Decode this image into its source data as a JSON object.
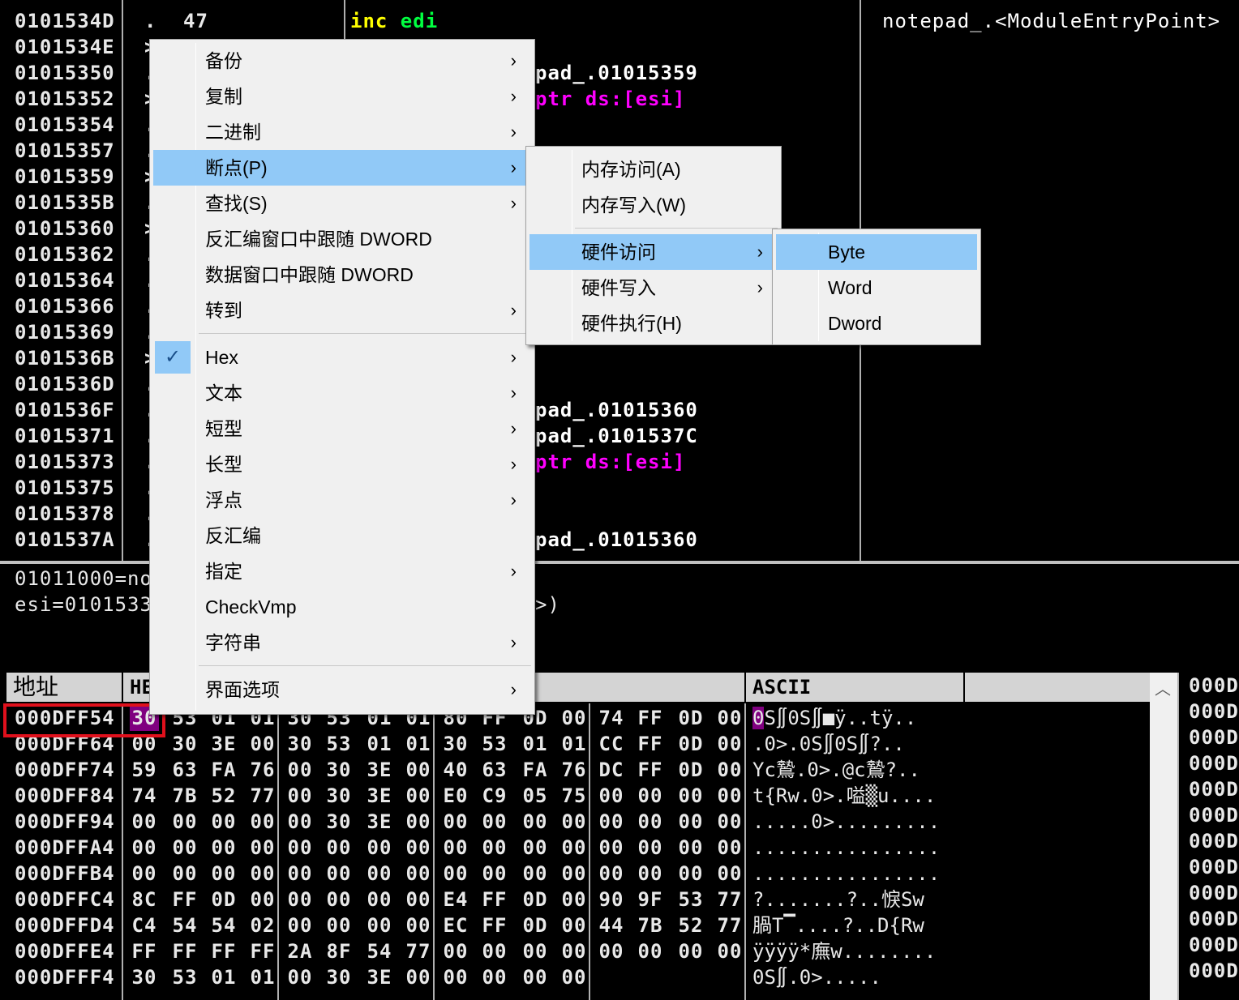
{
  "disasm": {
    "rows": [
      {
        "addr": "0101534D",
        "mark": ".",
        "bytes": "47",
        "instr": [
          {
            "t": "inc ",
            "c": "kw-y"
          },
          {
            "t": "edi",
            "c": "kw-g"
          }
        ]
      },
      {
        "addr": "0101534E",
        "mark": ">",
        "bytes": "",
        "instr": []
      },
      {
        "addr": "01015350",
        "mark": ".",
        "bytes": "",
        "instr": [
          {
            "t": "pad_.01015359",
            "c": "txt-w"
          }
        ]
      },
      {
        "addr": "01015352",
        "mark": ">",
        "bytes": "",
        "instr": [
          {
            "t": "ptr ds:[esi]",
            "c": "mag"
          }
        ]
      },
      {
        "addr": "01015354",
        "mark": ".",
        "bytes": "",
        "instr": []
      },
      {
        "addr": "01015357",
        "mark": ".",
        "bytes": "",
        "instr": []
      },
      {
        "addr": "01015359",
        "mark": ">",
        "bytes": "",
        "instr": []
      },
      {
        "addr": "0101535B",
        "mark": ".",
        "bytes": "",
        "instr": []
      },
      {
        "addr": "01015360",
        "mark": ">",
        "bytes": "",
        "instr": []
      },
      {
        "addr": "01015362",
        "mark": ".",
        "bytes": "",
        "instr": []
      },
      {
        "addr": "01015364",
        "mark": ".",
        "bytes": "",
        "instr": []
      },
      {
        "addr": "01015366",
        "mark": ".",
        "bytes": "",
        "instr": []
      },
      {
        "addr": "01015369",
        "mark": ".",
        "bytes": "",
        "instr": []
      },
      {
        "addr": "0101536B",
        "mark": ">",
        "bytes": "",
        "instr": []
      },
      {
        "addr": "0101536D",
        "mark": ".",
        "bytes": "",
        "instr": []
      },
      {
        "addr": "0101536F",
        "mark": ".",
        "bytes": "",
        "instr": [
          {
            "t": "pad_.01015360",
            "c": "txt-w"
          }
        ]
      },
      {
        "addr": "01015371",
        "mark": ".",
        "bytes": "",
        "instr": [
          {
            "t": "pad_.0101537C",
            "c": "txt-w"
          }
        ]
      },
      {
        "addr": "01015373",
        "mark": ".",
        "bytes": "",
        "instr": [
          {
            "t": "ptr ds:[esi]",
            "c": "mag"
          }
        ]
      },
      {
        "addr": "01015375",
        "mark": ".",
        "bytes": "",
        "instr": []
      },
      {
        "addr": "01015378",
        "mark": ".",
        "bytes": "",
        "instr": []
      },
      {
        "addr": "0101537A",
        "mark": ".",
        "bytes": "",
        "instr": [
          {
            "t": "pad_.01015360",
            "c": "txt-w"
          }
        ]
      }
    ],
    "comment": "notepad_.<ModuleEntryPoint>"
  },
  "info": {
    "line1": "01011000=no",
    "line2": "esi=0101533",
    "line2_tail": ">)"
  },
  "dump": {
    "col_addr": "地址",
    "col_hex": "HE",
    "col_ascii": "ASCII",
    "right_col": "000D",
    "rows": [
      {
        "addr": "000DFF54",
        "hex": [
          "30",
          "53",
          "01",
          "01",
          "30",
          "53",
          "01",
          "01",
          "80",
          "FF",
          "0D",
          "00",
          "74",
          "FF",
          "0D",
          "00"
        ],
        "ascii": "0S∬0S∬■ÿ..tÿ.."
      },
      {
        "addr": "000DFF64",
        "hex": [
          "00",
          "30",
          "3E",
          "00",
          "30",
          "53",
          "01",
          "01",
          "30",
          "53",
          "01",
          "01",
          "CC",
          "FF",
          "0D",
          "00"
        ],
        "ascii": ".0>.0S∬0S∬?.."
      },
      {
        "addr": "000DFF74",
        "hex": [
          "59",
          "63",
          "FA",
          "76",
          "00",
          "30",
          "3E",
          "00",
          "40",
          "63",
          "FA",
          "76",
          "DC",
          "FF",
          "0D",
          "00"
        ],
        "ascii": "Yc鷙.0>.@c鷙?.."
      },
      {
        "addr": "000DFF84",
        "hex": [
          "74",
          "7B",
          "52",
          "77",
          "00",
          "30",
          "3E",
          "00",
          "E0",
          "C9",
          "05",
          "75",
          "00",
          "00",
          "00",
          "00"
        ],
        "ascii": "t{Rw.0>.嗌▒u...."
      },
      {
        "addr": "000DFF94",
        "hex": [
          "00",
          "00",
          "00",
          "00",
          "00",
          "30",
          "3E",
          "00",
          "00",
          "00",
          "00",
          "00",
          "00",
          "00",
          "00",
          "00"
        ],
        "ascii": ".....0>........."
      },
      {
        "addr": "000DFFA4",
        "hex": [
          "00",
          "00",
          "00",
          "00",
          "00",
          "00",
          "00",
          "00",
          "00",
          "00",
          "00",
          "00",
          "00",
          "00",
          "00",
          "00"
        ],
        "ascii": "................"
      },
      {
        "addr": "000DFFB4",
        "hex": [
          "00",
          "00",
          "00",
          "00",
          "00",
          "00",
          "00",
          "00",
          "00",
          "00",
          "00",
          "00",
          "00",
          "00",
          "00",
          "00"
        ],
        "ascii": "................"
      },
      {
        "addr": "000DFFC4",
        "hex": [
          "8C",
          "FF",
          "0D",
          "00",
          "00",
          "00",
          "00",
          "00",
          "E4",
          "FF",
          "0D",
          "00",
          "90",
          "9F",
          "53",
          "77"
        ],
        "ascii": "?.......?..悷Sw"
      },
      {
        "addr": "000DFFD4",
        "hex": [
          "C4",
          "54",
          "54",
          "02",
          "00",
          "00",
          "00",
          "00",
          "EC",
          "FF",
          "0D",
          "00",
          "44",
          "7B",
          "52",
          "77"
        ],
        "ascii": "腡T▔....?..D{Rw"
      },
      {
        "addr": "000DFFE4",
        "hex": [
          "FF",
          "FF",
          "FF",
          "FF",
          "2A",
          "8F",
          "54",
          "77",
          "00",
          "00",
          "00",
          "00",
          "00",
          "00",
          "00",
          "00"
        ],
        "ascii": "ÿÿÿÿ*廡w........"
      },
      {
        "addr": "000DFFF4",
        "hex": [
          "30",
          "53",
          "01",
          "01",
          "00",
          "30",
          "3E",
          "00",
          "00",
          "00",
          "00",
          "00",
          "",
          "",
          "",
          ""
        ],
        "ascii": "0S∬.0>....."
      }
    ]
  },
  "menu": {
    "items": [
      {
        "label": "备份",
        "sub": true
      },
      {
        "label": "复制",
        "sub": true
      },
      {
        "label": "二进制",
        "sub": true
      },
      {
        "label": "断点(P)",
        "sub": true,
        "selected": true
      },
      {
        "label": "查找(S)",
        "sub": true
      },
      {
        "label": "反汇编窗口中跟随 DWORD",
        "sub": false
      },
      {
        "label": "数据窗口中跟随 DWORD",
        "sub": false
      },
      {
        "label": "转到",
        "sub": true
      },
      {
        "label": "Hex",
        "sub": true,
        "checked": true
      },
      {
        "label": "文本",
        "sub": true
      },
      {
        "label": "短型",
        "sub": true
      },
      {
        "label": "长型",
        "sub": true
      },
      {
        "label": "浮点",
        "sub": true
      },
      {
        "label": "反汇编",
        "sub": false
      },
      {
        "label": "指定",
        "sub": true
      },
      {
        "label": "CheckVmp",
        "sub": false
      },
      {
        "label": "字符串",
        "sub": true
      },
      {
        "label": "界面选项",
        "sub": true
      }
    ],
    "arrow_glyph": "›",
    "check_glyph": "✓"
  },
  "submenu_breakpoint": {
    "items": [
      {
        "label": "内存访问(A)",
        "sub": false
      },
      {
        "label": "内存写入(W)",
        "sub": false
      },
      {
        "label": "硬件访问",
        "sub": true,
        "selected": true
      },
      {
        "label": "硬件写入",
        "sub": true
      },
      {
        "label": "硬件执行(H)",
        "sub": false
      }
    ]
  },
  "submenu_hw": {
    "items": [
      {
        "label": "Byte",
        "selected": true
      },
      {
        "label": "Word"
      },
      {
        "label": "Dword"
      }
    ]
  },
  "colors": {
    "menu_highlight": "#91c9f7",
    "selected_byte_bg": "#800080",
    "annotation_box": "#e0101c"
  }
}
